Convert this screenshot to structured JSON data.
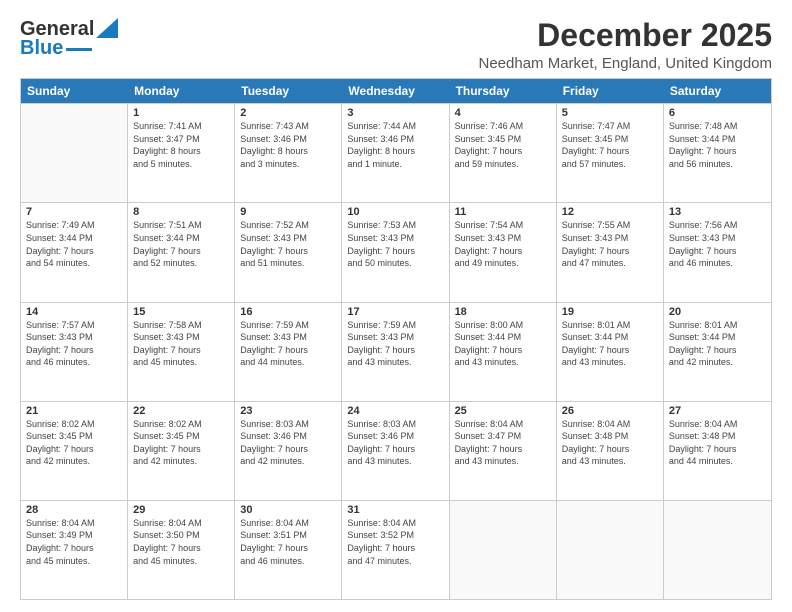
{
  "logo": {
    "line1": "General",
    "line2": "Blue"
  },
  "header": {
    "title": "December 2025",
    "subtitle": "Needham Market, England, United Kingdom"
  },
  "days_of_week": [
    "Sunday",
    "Monday",
    "Tuesday",
    "Wednesday",
    "Thursday",
    "Friday",
    "Saturday"
  ],
  "weeks": [
    [
      {
        "num": "",
        "info": ""
      },
      {
        "num": "1",
        "info": "Sunrise: 7:41 AM\nSunset: 3:47 PM\nDaylight: 8 hours\nand 5 minutes."
      },
      {
        "num": "2",
        "info": "Sunrise: 7:43 AM\nSunset: 3:46 PM\nDaylight: 8 hours\nand 3 minutes."
      },
      {
        "num": "3",
        "info": "Sunrise: 7:44 AM\nSunset: 3:46 PM\nDaylight: 8 hours\nand 1 minute."
      },
      {
        "num": "4",
        "info": "Sunrise: 7:46 AM\nSunset: 3:45 PM\nDaylight: 7 hours\nand 59 minutes."
      },
      {
        "num": "5",
        "info": "Sunrise: 7:47 AM\nSunset: 3:45 PM\nDaylight: 7 hours\nand 57 minutes."
      },
      {
        "num": "6",
        "info": "Sunrise: 7:48 AM\nSunset: 3:44 PM\nDaylight: 7 hours\nand 56 minutes."
      }
    ],
    [
      {
        "num": "7",
        "info": "Sunrise: 7:49 AM\nSunset: 3:44 PM\nDaylight: 7 hours\nand 54 minutes."
      },
      {
        "num": "8",
        "info": "Sunrise: 7:51 AM\nSunset: 3:44 PM\nDaylight: 7 hours\nand 52 minutes."
      },
      {
        "num": "9",
        "info": "Sunrise: 7:52 AM\nSunset: 3:43 PM\nDaylight: 7 hours\nand 51 minutes."
      },
      {
        "num": "10",
        "info": "Sunrise: 7:53 AM\nSunset: 3:43 PM\nDaylight: 7 hours\nand 50 minutes."
      },
      {
        "num": "11",
        "info": "Sunrise: 7:54 AM\nSunset: 3:43 PM\nDaylight: 7 hours\nand 49 minutes."
      },
      {
        "num": "12",
        "info": "Sunrise: 7:55 AM\nSunset: 3:43 PM\nDaylight: 7 hours\nand 47 minutes."
      },
      {
        "num": "13",
        "info": "Sunrise: 7:56 AM\nSunset: 3:43 PM\nDaylight: 7 hours\nand 46 minutes."
      }
    ],
    [
      {
        "num": "14",
        "info": "Sunrise: 7:57 AM\nSunset: 3:43 PM\nDaylight: 7 hours\nand 46 minutes."
      },
      {
        "num": "15",
        "info": "Sunrise: 7:58 AM\nSunset: 3:43 PM\nDaylight: 7 hours\nand 45 minutes."
      },
      {
        "num": "16",
        "info": "Sunrise: 7:59 AM\nSunset: 3:43 PM\nDaylight: 7 hours\nand 44 minutes."
      },
      {
        "num": "17",
        "info": "Sunrise: 7:59 AM\nSunset: 3:43 PM\nDaylight: 7 hours\nand 43 minutes."
      },
      {
        "num": "18",
        "info": "Sunrise: 8:00 AM\nSunset: 3:44 PM\nDaylight: 7 hours\nand 43 minutes."
      },
      {
        "num": "19",
        "info": "Sunrise: 8:01 AM\nSunset: 3:44 PM\nDaylight: 7 hours\nand 43 minutes."
      },
      {
        "num": "20",
        "info": "Sunrise: 8:01 AM\nSunset: 3:44 PM\nDaylight: 7 hours\nand 42 minutes."
      }
    ],
    [
      {
        "num": "21",
        "info": "Sunrise: 8:02 AM\nSunset: 3:45 PM\nDaylight: 7 hours\nand 42 minutes."
      },
      {
        "num": "22",
        "info": "Sunrise: 8:02 AM\nSunset: 3:45 PM\nDaylight: 7 hours\nand 42 minutes."
      },
      {
        "num": "23",
        "info": "Sunrise: 8:03 AM\nSunset: 3:46 PM\nDaylight: 7 hours\nand 42 minutes."
      },
      {
        "num": "24",
        "info": "Sunrise: 8:03 AM\nSunset: 3:46 PM\nDaylight: 7 hours\nand 43 minutes."
      },
      {
        "num": "25",
        "info": "Sunrise: 8:04 AM\nSunset: 3:47 PM\nDaylight: 7 hours\nand 43 minutes."
      },
      {
        "num": "26",
        "info": "Sunrise: 8:04 AM\nSunset: 3:48 PM\nDaylight: 7 hours\nand 43 minutes."
      },
      {
        "num": "27",
        "info": "Sunrise: 8:04 AM\nSunset: 3:48 PM\nDaylight: 7 hours\nand 44 minutes."
      }
    ],
    [
      {
        "num": "28",
        "info": "Sunrise: 8:04 AM\nSunset: 3:49 PM\nDaylight: 7 hours\nand 45 minutes."
      },
      {
        "num": "29",
        "info": "Sunrise: 8:04 AM\nSunset: 3:50 PM\nDaylight: 7 hours\nand 45 minutes."
      },
      {
        "num": "30",
        "info": "Sunrise: 8:04 AM\nSunset: 3:51 PM\nDaylight: 7 hours\nand 46 minutes."
      },
      {
        "num": "31",
        "info": "Sunrise: 8:04 AM\nSunset: 3:52 PM\nDaylight: 7 hours\nand 47 minutes."
      },
      {
        "num": "",
        "info": ""
      },
      {
        "num": "",
        "info": ""
      },
      {
        "num": "",
        "info": ""
      }
    ]
  ]
}
